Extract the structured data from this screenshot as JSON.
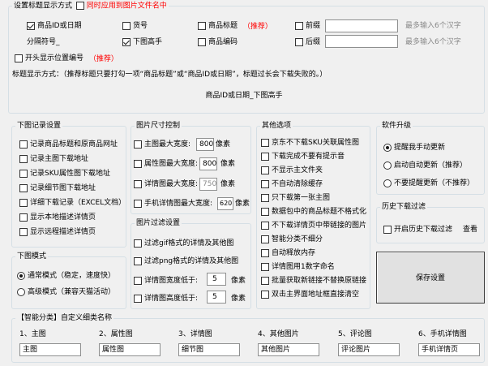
{
  "title_settings": {
    "legend": "设置标题显示方式",
    "sync_label": "同时应用到图片文件名中",
    "options": [
      {
        "label": "商品ID或日期",
        "checked": true
      },
      {
        "label": "货号",
        "checked": false
      },
      {
        "label": "商品标题",
        "checked": false,
        "note": "（推荐）"
      },
      {
        "label": "前缀",
        "checked": false
      },
      {
        "label": "下图高手",
        "checked": true
      },
      {
        "label": "商品编码",
        "checked": false
      },
      {
        "label": "后缀",
        "checked": false
      }
    ],
    "separator_label": "分隔符号_",
    "hint_chars": "最多输入6个汉字",
    "hint_chars2": "最多输入6个汉字",
    "position_label": "开头显示位置编号",
    "position_note": "（推荐）",
    "method_text": "标题显示方式：（推荐标题只要打勾一项“商品标题”或“商品ID或日期”，标题过长会下载失败的。）",
    "preview": "商品ID或日期_下图高手"
  },
  "download_record": {
    "legend": "下图记录设置",
    "items": [
      {
        "label": "记录商品标题和原商品网址",
        "checked": false
      },
      {
        "label": "记录主图下载地址",
        "checked": false
      },
      {
        "label": "记录SKU属性图下载地址",
        "checked": false
      },
      {
        "label": "记录细节图下载地址",
        "checked": false
      },
      {
        "label": "详细下载记录（EXCEL文档）",
        "checked": false
      },
      {
        "label": "显示本地描述详情页",
        "checked": false
      },
      {
        "label": "显示远程描述详情页",
        "checked": false
      }
    ]
  },
  "image_size": {
    "legend": "图片尺寸控制",
    "items": [
      {
        "label": "主图最大宽度:",
        "value": "800",
        "unit": "像素"
      },
      {
        "label": "属性图最大宽度:",
        "value": "800",
        "unit": "像素"
      },
      {
        "label": "详情图最大宽度:",
        "value": "750",
        "unit": "像素"
      },
      {
        "label": "手机详情图最大宽度:",
        "value": "620",
        "unit": "像素"
      }
    ]
  },
  "image_filter": {
    "legend": "图片过滤设置",
    "items": [
      {
        "label": "过滤gif格式的详情及其他图"
      },
      {
        "label": "过滤png格式的详情及其他图"
      },
      {
        "label": "详情图宽度低于:",
        "value": "5",
        "unit": "像素"
      },
      {
        "label": "详情图高度低于:",
        "value": "5",
        "unit": "像素"
      }
    ]
  },
  "other_options": {
    "legend": "其他选项",
    "items": [
      {
        "label": "京东不下载SKU关联属性图"
      },
      {
        "label": "下载完成不要有提示音"
      },
      {
        "label": "不显示主文件夹"
      },
      {
        "label": "不自动清除缓存"
      },
      {
        "label": "只下载第一张主图"
      },
      {
        "label": "数据包中的商品标题不格式化"
      },
      {
        "label": "不下载详情页中带链接的图片"
      },
      {
        "label": "智能分类不细分"
      },
      {
        "label": "自动释放内存"
      },
      {
        "label": "详情图用1数字命名"
      },
      {
        "label": "批量获取新链接不替换原链接"
      },
      {
        "label": "双击主界面地址框直接清空"
      }
    ]
  },
  "software_upgrade": {
    "legend": "软件升级",
    "items": [
      {
        "label": "提醒我手动更新",
        "selected": true
      },
      {
        "label": "启动自动更新（推荐）",
        "selected": false
      },
      {
        "label": "不要提醒更新（不推荐）",
        "selected": false
      }
    ]
  },
  "history_filter": {
    "legend": "历史下载过滤",
    "label": "开启历史下载过滤",
    "view": "查看"
  },
  "save_button": "保存设置",
  "download_mode": {
    "legend": "下图模式",
    "items": [
      {
        "label": "通常模式（稳定，速度快）",
        "selected": true
      },
      {
        "label": "高级模式（兼容天猫活动）",
        "selected": false
      }
    ]
  },
  "smart_category": {
    "legend": "【智能分类】自定义细类名称",
    "items": [
      {
        "label": "1、主图",
        "value": "主图"
      },
      {
        "label": "2、属性图",
        "value": "属性图"
      },
      {
        "label": "3、详情图",
        "value": "细节图"
      },
      {
        "label": "4、其他图片",
        "value": "其他图片"
      },
      {
        "label": "5、评论图",
        "value": "评论图片"
      },
      {
        "label": "6、手机详情图",
        "value": "手机详情页"
      }
    ]
  }
}
